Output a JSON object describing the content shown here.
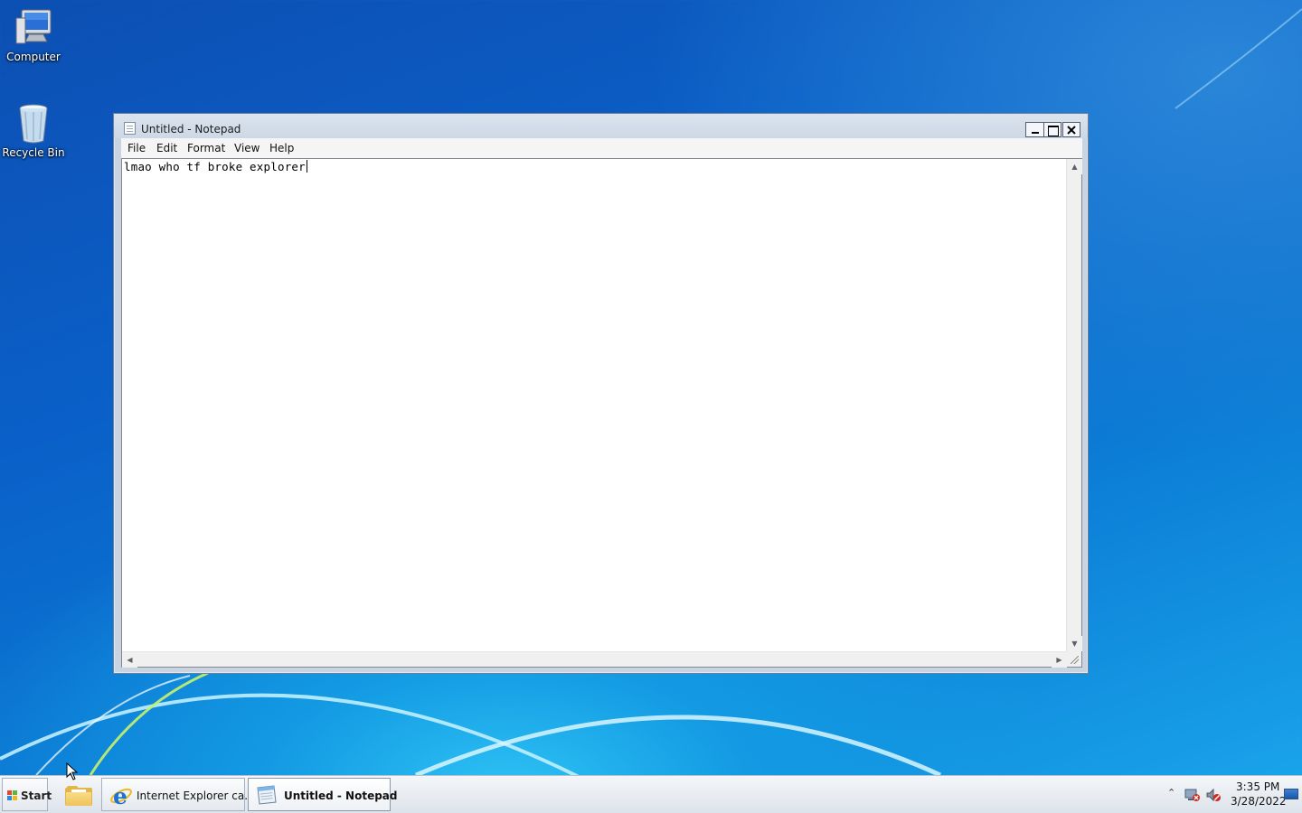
{
  "desktop": {
    "icons": [
      {
        "label": "Computer",
        "icon": "computer-icon"
      },
      {
        "label": "Recycle Bin",
        "icon": "recycle-bin-icon"
      }
    ]
  },
  "window": {
    "title": "Untitled - Notepad",
    "icon": "notepad-icon",
    "controls": {
      "minimize": "minimize-icon",
      "maximize": "maximize-icon",
      "close": "close-icon"
    },
    "menu": [
      "File",
      "Edit",
      "Format",
      "View",
      "Help"
    ],
    "content": "lmao who tf broke explorer"
  },
  "taskbar": {
    "start_label": "Start",
    "items": [
      {
        "label": "",
        "icon": "folder-icon"
      },
      {
        "label": "Internet Explorer ca...",
        "icon": "internet-explorer-icon"
      },
      {
        "label": "Untitled - Notepad",
        "icon": "notepad-icon",
        "active": true
      }
    ],
    "tray": {
      "time": "3:35 PM",
      "date": "3/28/2022",
      "icons": [
        "show-hidden-icons-icon",
        "network-disconnected-icon",
        "volume-muted-icon",
        "show-desktop-icon"
      ]
    }
  },
  "colors": {
    "desktop_blue": "#0b66c9",
    "taskbar": "#e8ecf1",
    "window_frame": "#c9d4e2"
  }
}
